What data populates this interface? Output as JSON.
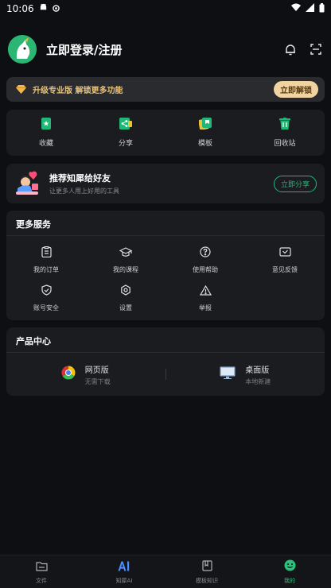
{
  "status_bar": {
    "time": "10:06"
  },
  "profile": {
    "login_text": "立即登录/注册"
  },
  "upgrade": {
    "text": "升级专业版 解锁更多功能",
    "button": "立即解锁"
  },
  "quick_actions": [
    {
      "label": "收藏",
      "icon": "bookmark-icon"
    },
    {
      "label": "分享",
      "icon": "share-icon"
    },
    {
      "label": "模板",
      "icon": "template-icon"
    },
    {
      "label": "回收站",
      "icon": "trash-icon"
    }
  ],
  "share_card": {
    "title": "推荐知犀给好友",
    "subtitle": "让更多人用上好用的工具",
    "button": "立即分享"
  },
  "services": {
    "title": "更多服务",
    "items": [
      {
        "label": "我的订单",
        "icon": "order-icon"
      },
      {
        "label": "我的课程",
        "icon": "course-icon"
      },
      {
        "label": "使用帮助",
        "icon": "help-icon"
      },
      {
        "label": "意见反馈",
        "icon": "feedback-icon"
      },
      {
        "label": "账号安全",
        "icon": "shield-icon"
      },
      {
        "label": "设置",
        "icon": "settings-icon"
      },
      {
        "label": "举报",
        "icon": "report-icon"
      }
    ]
  },
  "products": {
    "title": "产品中心",
    "items": [
      {
        "title": "网页版",
        "subtitle": "无需下载",
        "icon": "chrome-icon"
      },
      {
        "title": "桌面版",
        "subtitle": "本地新建",
        "icon": "desktop-icon"
      }
    ]
  },
  "bottom_nav": [
    {
      "label": "文件",
      "icon": "folder-icon"
    },
    {
      "label": "知犀AI",
      "icon": "ai-icon"
    },
    {
      "label": "模板知识",
      "icon": "book-icon"
    },
    {
      "label": "我的",
      "icon": "smile-icon"
    }
  ],
  "colors": {
    "accent": "#20b877",
    "gold": "#e7c27a",
    "background": "#0e0f12",
    "card": "#1b1c20"
  }
}
